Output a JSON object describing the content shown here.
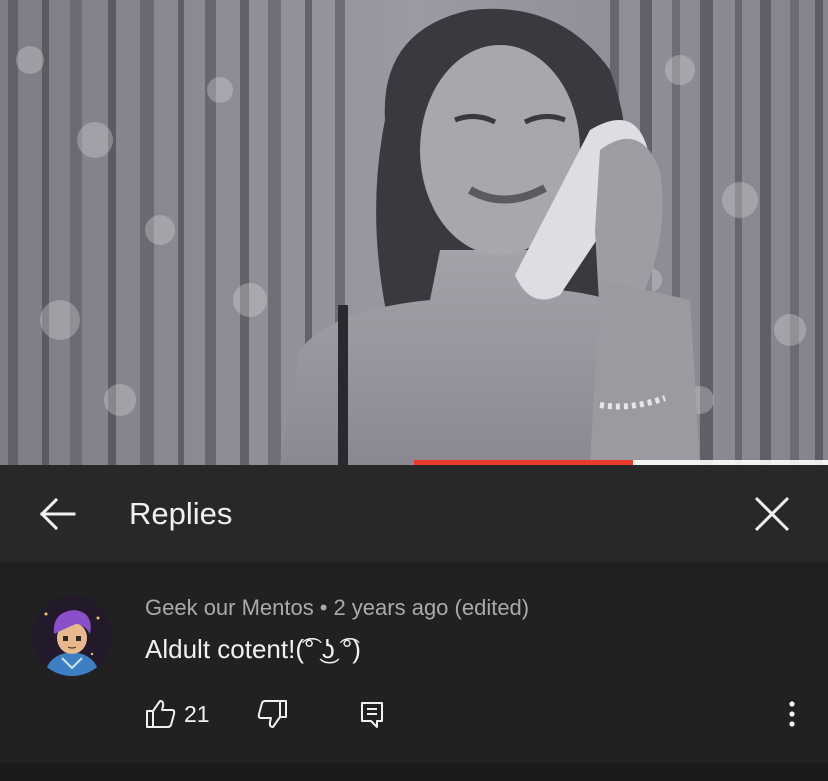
{
  "player": {
    "progress_fraction": 0.53,
    "progress_color": "#ee3a2c"
  },
  "header": {
    "title": "Replies",
    "back_icon": "arrow-left-icon",
    "close_icon": "close-icon"
  },
  "comment": {
    "author": "Geek our Mentos",
    "separator": "•",
    "time": "2 years ago (edited)",
    "text": "Aldult cotent!(͡° ͜ʖ ͡°)",
    "like_count": "21",
    "icons": {
      "like": "thumbs-up-icon",
      "dislike": "thumbs-down-icon",
      "reply": "reply-icon",
      "more": "more-vertical-icon"
    }
  }
}
